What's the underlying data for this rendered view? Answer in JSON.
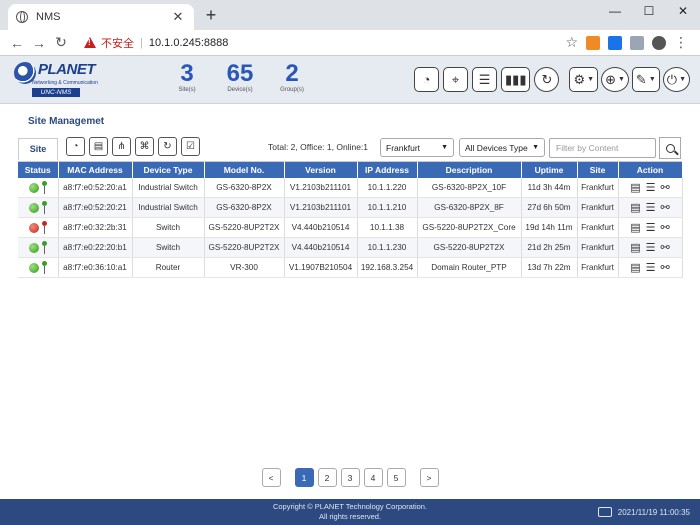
{
  "browser": {
    "tab_title": "NMS",
    "insecure_label": "不安全",
    "url": "10.1.0.245:8888"
  },
  "app": {
    "brand": "PLANET",
    "tagline": "Networking & Communication",
    "product": "UNC-NMS",
    "stats": [
      {
        "value": "3",
        "label": "Site(s)"
      },
      {
        "value": "65",
        "label": "Device(s)"
      },
      {
        "value": "2",
        "label": "Group(s)"
      }
    ]
  },
  "page": {
    "title": "Site Managemet",
    "tab_label": "Site",
    "totals": "Total: 2, Office: 1, Online:1",
    "site_select": "Frankfurt",
    "device_select": "All Devices Type",
    "filter_placeholder": "Filter by Content"
  },
  "table": {
    "columns": [
      "Status",
      "MAC Address",
      "Device Type",
      "Model No.",
      "Version",
      "IP Address",
      "Description",
      "Uptime",
      "Site",
      "Action"
    ],
    "rows": [
      {
        "status": "online",
        "mac": "a8:f7:e0:52:20:a1",
        "type": "Industrial Switch",
        "model": "GS-6320-8P2X",
        "version": "V1.2103b211101",
        "ip": "10.1.1.220",
        "desc": "GS-6320-8P2X_10F",
        "uptime": "11d 3h 44m",
        "site": "Frankfurt"
      },
      {
        "status": "online",
        "mac": "a8:f7:e0:52:20:21",
        "type": "Industrial Switch",
        "model": "GS-6320-8P2X",
        "version": "V1.2103b211101",
        "ip": "10.1.1.210",
        "desc": "GS-6320-8P2X_8F",
        "uptime": "27d 6h 50m",
        "site": "Frankfurt"
      },
      {
        "status": "offline",
        "mac": "a8:f7:e0:32:2b:31",
        "type": "Switch",
        "model": "GS-5220-8UP2T2X",
        "version": "V4.440b210514",
        "ip": "10.1.1.38",
        "desc": "GS-5220-8UP2T2X_Core",
        "uptime": "19d 14h 11m",
        "site": "Frankfurt"
      },
      {
        "status": "online",
        "mac": "a8:f7:e0:22:20:b1",
        "type": "Switch",
        "model": "GS-5220-8UP2T2X",
        "version": "V4.440b210514",
        "ip": "10.1.1.230",
        "desc": "GS-5220-8UP2T2X",
        "uptime": "21d 2h 25m",
        "site": "Frankfurt"
      },
      {
        "status": "online",
        "mac": "a8:f7:e0:36:10:a1",
        "type": "Router",
        "model": "VR-300",
        "version": "V1.1907B210504",
        "ip": "192.168.3.254",
        "desc": "Domain Router_PTP",
        "uptime": "13d 7h 22m",
        "site": "Frankfurt"
      }
    ]
  },
  "pagination": {
    "prev": "<",
    "next": ">",
    "pages": [
      "1",
      "2",
      "3",
      "4",
      "5"
    ],
    "active": "1"
  },
  "footer": {
    "copyright_line1": "Copyright © PLANET Technology Corporation.",
    "copyright_line2": "All rights reserved.",
    "datetime": "2021/11/19 11:00:35"
  },
  "colors": {
    "header_blue": "#3a6ab5",
    "footer_blue": "#2c4a80",
    "online": "#2f9a1e",
    "offline": "#c22a1e"
  }
}
